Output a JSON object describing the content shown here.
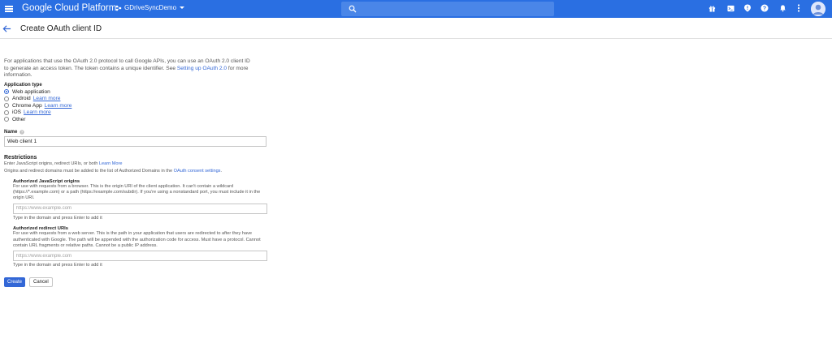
{
  "topbar": {
    "brand": "Google Cloud Platform",
    "project": "GDriveSyncDemo",
    "search_placeholder": "",
    "icons": [
      "gift-icon",
      "terminal-icon",
      "alert-icon",
      "help-icon",
      "notifications-icon",
      "more-vert-icon"
    ],
    "color": "#2a6fe2"
  },
  "header": {
    "title": "Create OAuth client ID"
  },
  "intro": {
    "text": "For applications that use the OAuth 2.0 protocol to call Google APIs, you can use an OAuth 2.0 client ID to generate an access token. The token contains a unique identifier. See ",
    "link": "Setting up OAuth 2.0",
    "suffix": " for more information."
  },
  "app_type": {
    "label": "Application type",
    "options": [
      {
        "label": "Web application",
        "learn": "",
        "checked": true
      },
      {
        "label": "Android",
        "learn": "Learn more",
        "checked": false
      },
      {
        "label": "Chrome App",
        "learn": "Learn more",
        "checked": false
      },
      {
        "label": "iOS",
        "learn": "Learn more",
        "checked": false
      },
      {
        "label": "Other",
        "learn": "",
        "checked": false
      }
    ]
  },
  "name": {
    "label": "Name",
    "value": "Web client 1"
  },
  "restrictions": {
    "title": "Restrictions",
    "desc": "Enter JavaScript origins, redirect URIs, or both ",
    "desc_link": "Learn More",
    "domains_note": "Origins and redirect domains must be added to the list of Authorized Domains in the ",
    "domains_link": "OAuth consent settings",
    "domains_suffix": ".",
    "js_origins": {
      "title": "Authorized JavaScript origins",
      "desc": "For use with requests from a browser. This is the origin URI of the client application. It can't contain a wildcard (https://*.example.com) or a path (https://example.com/subdir). If you're using a nonstandard port, you must include it in the origin URI.",
      "placeholder": "https://www.example.com",
      "hint": "Type in the domain and press Enter to add it"
    },
    "redirect_uris": {
      "title": "Authorized redirect URIs",
      "desc": "For use with requests from a web server. This is the path in your application that users are redirected to after they have authenticated with Google. The path will be appended with the authorization code for access. Must have a protocol. Cannot contain URL fragments or relative paths. Cannot be a public IP address.",
      "placeholder": "https://www.example.com",
      "hint": "Type in the domain and press Enter to add it"
    }
  },
  "actions": {
    "create": "Create",
    "cancel": "Cancel"
  }
}
